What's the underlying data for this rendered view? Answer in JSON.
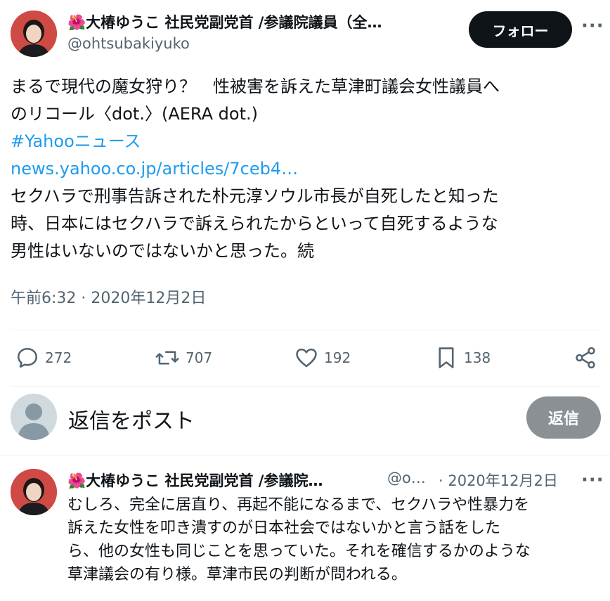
{
  "tweet": {
    "author_name": "🌺大椿ゆうこ 社民党副党首 /参議院議員（全…",
    "author_handle": "@ohtsubakiyuko",
    "follow_label": "フォロー",
    "more_label": "···",
    "text_line1": "まるで現代の魔女狩り？　性被害を訴えた草津町議会女性議員へ",
    "text_line2": "のリコール〈dot.〉(AERA dot.)",
    "hashtag": "#Yahooニュース",
    "link": "news.yahoo.co.jp/articles/7ceb4…",
    "text_line3": "セクハラで刑事告訴された朴元淳ソウル市長が自死したと知った",
    "text_line4": "時、日本にはセクハラで訴えられたからといって自死するような",
    "text_line5": "男性はいないのではないかと思った。続",
    "timestamp": "午前6:32 · 2020年12月2日"
  },
  "actions": {
    "replies": "272",
    "retweets": "707",
    "likes": "192",
    "bookmarks": "138"
  },
  "composer": {
    "placeholder": "返信をポスト",
    "reply_button": "返信"
  },
  "reply": {
    "author_name": "🌺大椿ゆうこ 社民党副党首 /参議院…",
    "author_handle": "@o…",
    "date": "· 2020年12月2日",
    "more_label": "···",
    "line1": "むしろ、完全に居直り、再起不能になるまで、セクハラや性暴力を",
    "line2": "訴えた女性を叩き潰すのが日本社会ではないかと言う話をした",
    "line3": "ら、他の女性も同じことを思っていた。それを確信するかのような",
    "line4": "草津議会の有り様。草津市民の判断が問われる。"
  },
  "colors": {
    "link": "#1d9bf0",
    "secondary": "#536471",
    "follow_bg": "#0f1419",
    "reply_btn_bg": "#8b9095"
  },
  "icons": [
    "reply-icon",
    "retweet-icon",
    "like-icon",
    "bookmark-icon",
    "share-icon",
    "default-avatar-icon"
  ]
}
